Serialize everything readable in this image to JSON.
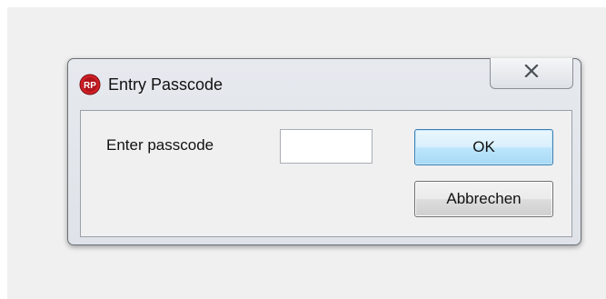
{
  "dialog": {
    "title": "Entry Passcode",
    "app_icon": "rp-app-icon",
    "app_icon_text": "RP",
    "close_icon": "close-x-icon"
  },
  "form": {
    "passcode_label": "Enter passcode",
    "passcode_value": "",
    "ok_label": "OK",
    "cancel_label": "Abbrechen"
  },
  "colors": {
    "ok_button_border": "#3c7fb1",
    "icon_red": "#d21f26"
  }
}
